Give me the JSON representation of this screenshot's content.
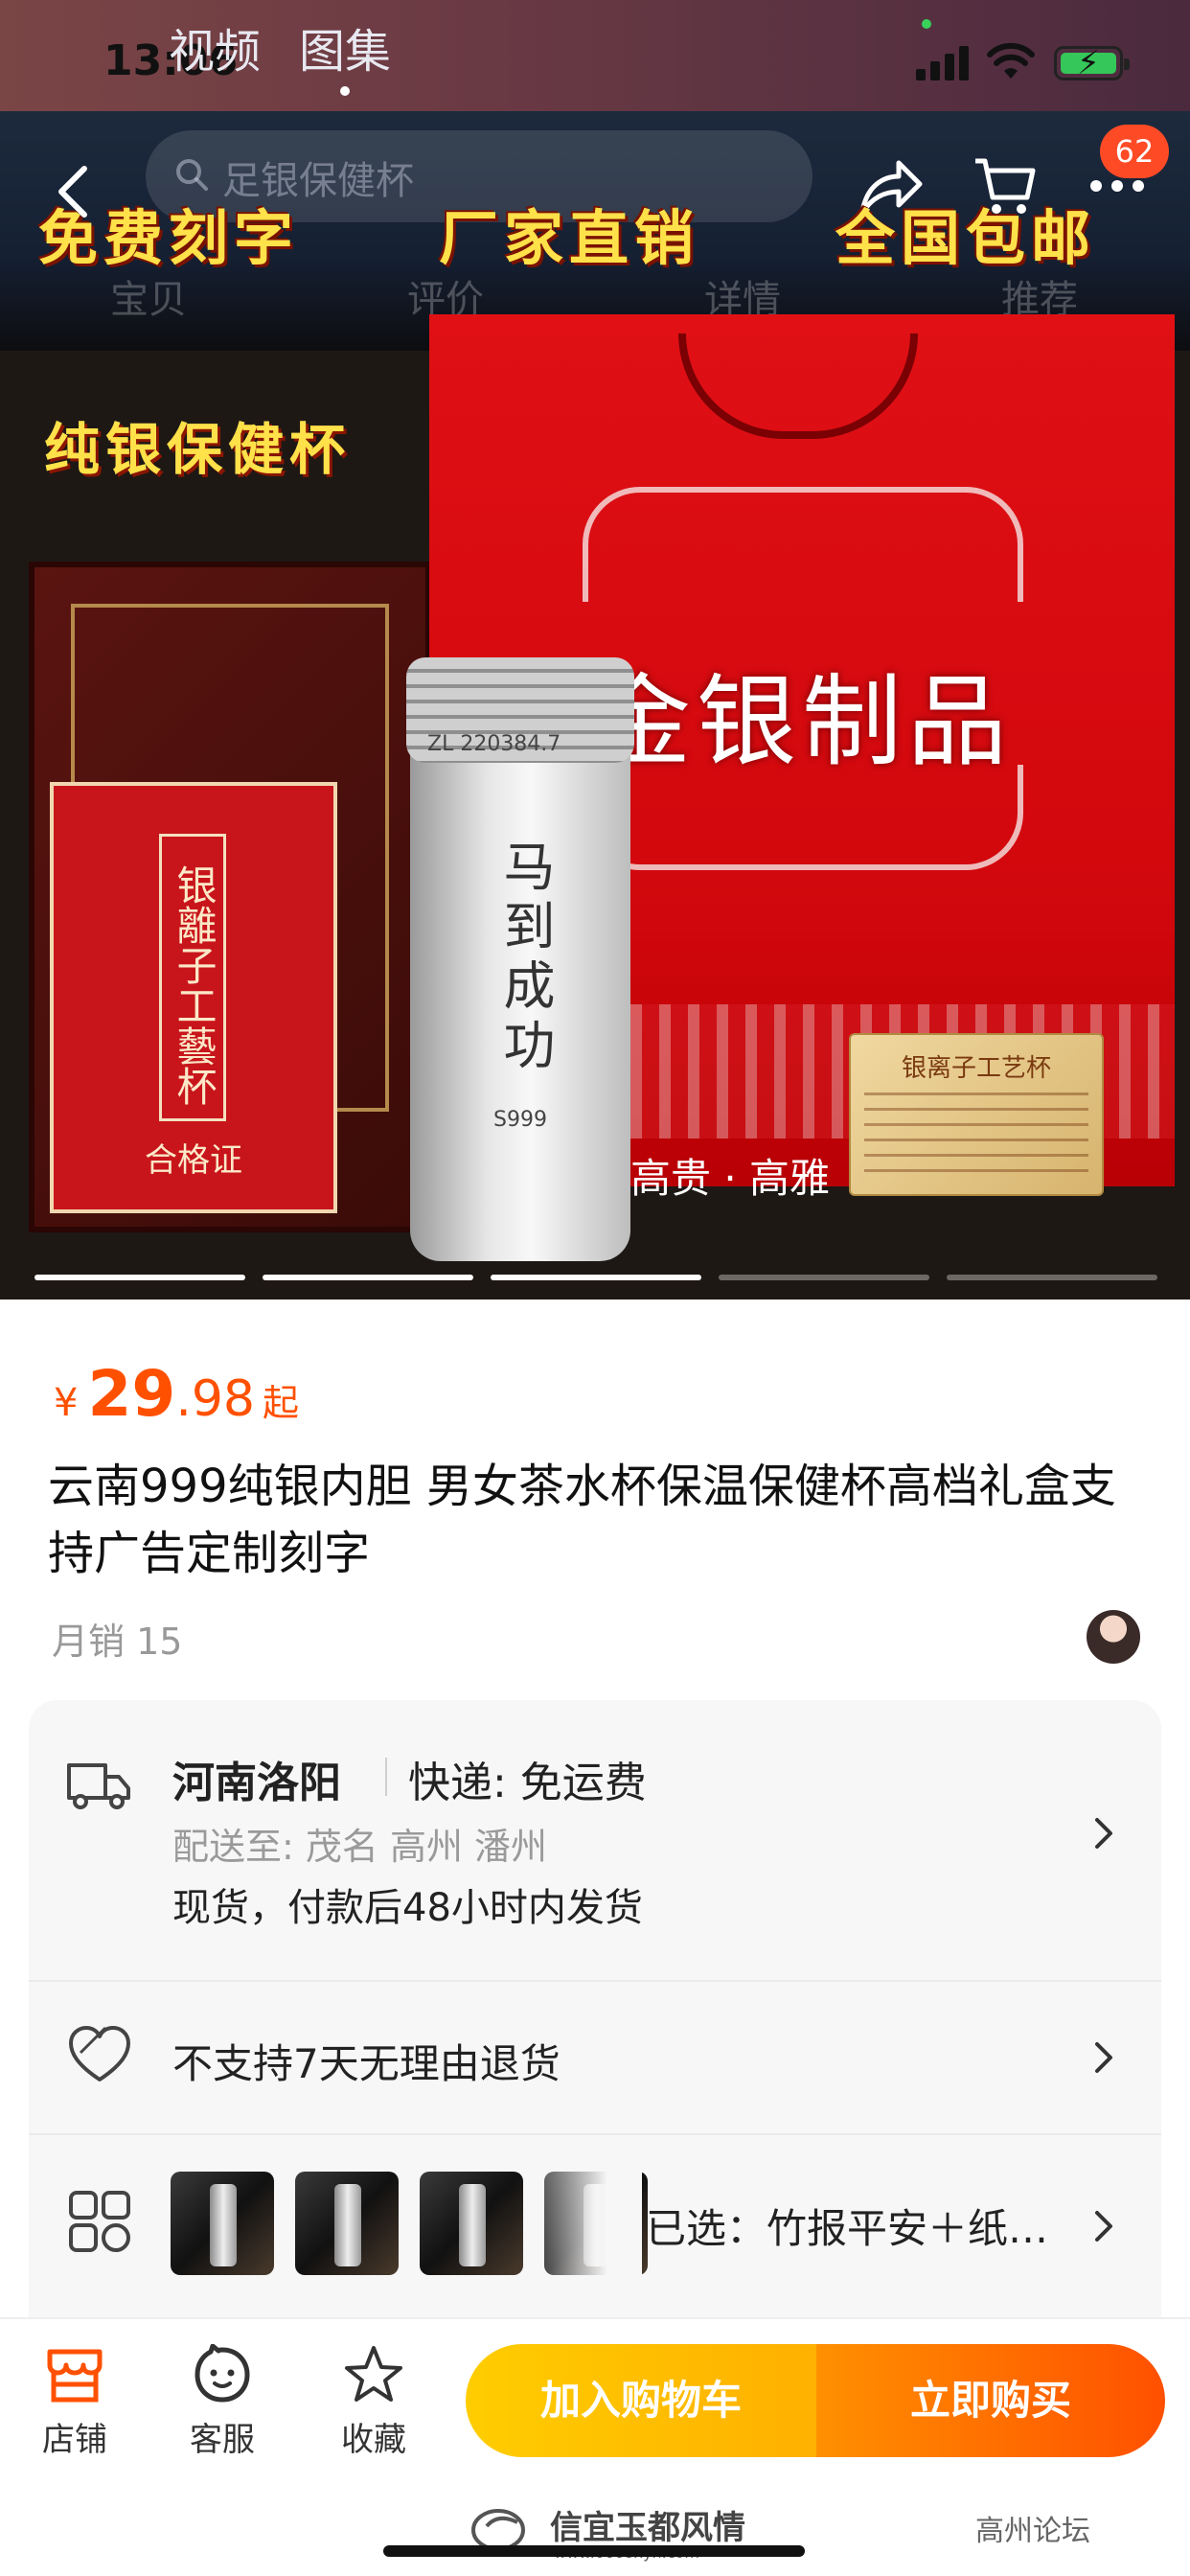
{
  "status_bar": {
    "time": "13:06",
    "media_tabs": [
      "视频",
      "图集"
    ],
    "active_media_tab": 1
  },
  "header": {
    "search_placeholder": "足银保健杯",
    "cart_badge": "62",
    "tabs": [
      "宝贝",
      "评价",
      "详情",
      "推荐"
    ]
  },
  "hero": {
    "slogans": [
      "免费刻字",
      "厂家直销",
      "全国包邮"
    ],
    "subtitle": "纯银保健杯",
    "bag_title": "金银制品",
    "bag_tagline": "高贵 · 高雅",
    "certificate_title": "银離子工藝杯",
    "certificate_label": "合格证",
    "cup_engraving": "马到成功",
    "cup_lid_code": "ZL 220384.7",
    "cup_mark": "S999",
    "gold_card_title": "银离子工艺杯",
    "pager_total": 5,
    "pager_active": 2
  },
  "product": {
    "currency": "¥",
    "price_int": "29",
    "price_dec": ".98",
    "price_suffix": "起",
    "title": "云南999纯银内胆 男女茶水杯保温保健杯高档礼盒支持广告定制刻字",
    "monthly_sales": "月销 15"
  },
  "shipping": {
    "origin": "河南洛阳",
    "express": "快递: 免运费",
    "destination": "配送至: 茂名 高州 潘州",
    "dispatch": "现货，付款后48小时内发货"
  },
  "returns": {
    "text": "不支持7天无理由退货"
  },
  "sku": {
    "selected": "已选：竹报平安＋纸…",
    "thumbnail_count": 4
  },
  "bottom_bar": {
    "store": "店铺",
    "service": "客服",
    "favorite": "收藏",
    "add_to_cart": "加入购物车",
    "buy_now": "立即购买",
    "watermark": "信宜玉都风情",
    "watermark_sub": "www.0668xyh.com",
    "wechat_mark": "高州论坛"
  },
  "colors": {
    "accent_orange": "#ff5000",
    "cart_yellow": "#ffb000",
    "badge_red": "#ff4a26"
  }
}
